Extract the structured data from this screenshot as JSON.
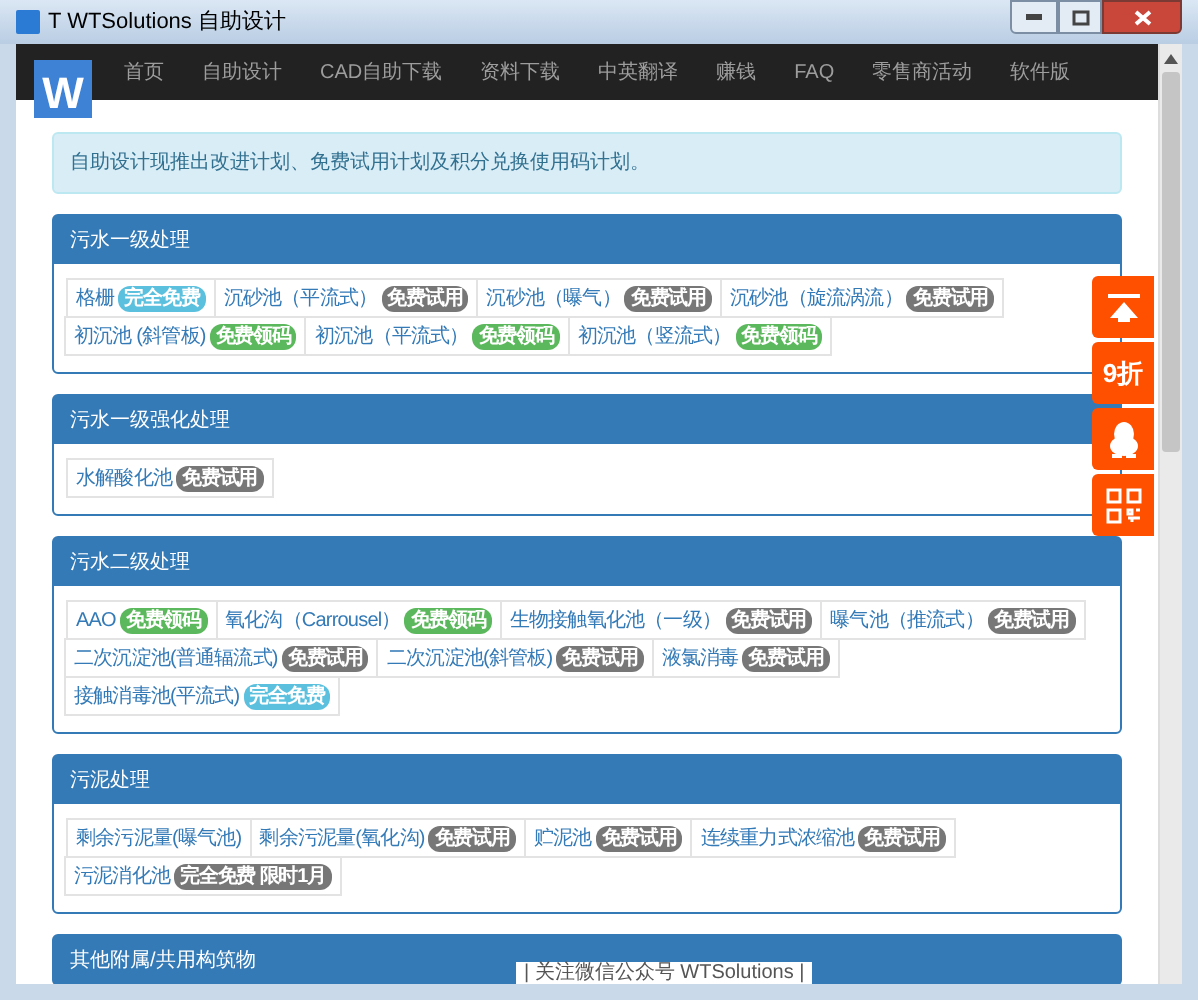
{
  "window": {
    "title": "T WTSolutions 自助设计"
  },
  "nav": {
    "logo": "W",
    "items": [
      "首页",
      "自助设计",
      "CAD自助下载",
      "资料下载",
      "中英翻译",
      "赚钱",
      "FAQ",
      "零售商活动",
      "软件版"
    ]
  },
  "notice": "自助设计现推出改进计划、免费试用计划及积分兑换使用码计划。",
  "panels": [
    {
      "title": "污水一级处理",
      "items": [
        {
          "label": "格栅",
          "badge": {
            "text": "完全免费",
            "color": "#5bc0de"
          }
        },
        {
          "label": "沉砂池（平流式）",
          "badge": {
            "text": "免费试用",
            "color": "#777777"
          }
        },
        {
          "label": "沉砂池（曝气）",
          "badge": {
            "text": "免费试用",
            "color": "#777777"
          }
        },
        {
          "label": "沉砂池（旋流涡流）",
          "badge": {
            "text": "免费试用",
            "color": "#777777"
          }
        },
        {
          "label": "初沉池 (斜管板)",
          "badge": {
            "text": "免费领码",
            "color": "#5cb85c"
          }
        },
        {
          "label": "初沉池（平流式）",
          "badge": {
            "text": "免费领码",
            "color": "#5cb85c"
          }
        },
        {
          "label": "初沉池（竖流式）",
          "badge": {
            "text": "免费领码",
            "color": "#5cb85c"
          }
        }
      ]
    },
    {
      "title": "污水一级强化处理",
      "items": [
        {
          "label": "水解酸化池",
          "badge": {
            "text": "免费试用",
            "color": "#777777"
          }
        }
      ]
    },
    {
      "title": "污水二级处理",
      "items": [
        {
          "label": "AAO",
          "badge": {
            "text": "免费领码",
            "color": "#5cb85c"
          }
        },
        {
          "label": "氧化沟（Carrousel）",
          "badge": {
            "text": "免费领码",
            "color": "#5cb85c"
          }
        },
        {
          "label": "生物接触氧化池（一级）",
          "badge": {
            "text": "免费试用",
            "color": "#777777"
          }
        },
        {
          "label": "曝气池（推流式）",
          "badge": {
            "text": "免费试用",
            "color": "#777777"
          }
        },
        {
          "label": "二次沉淀池(普通辐流式)",
          "badge": {
            "text": "免费试用",
            "color": "#777777"
          }
        },
        {
          "label": "二次沉淀池(斜管板)",
          "badge": {
            "text": "免费试用",
            "color": "#777777"
          }
        },
        {
          "label": "液氯消毒",
          "badge": {
            "text": "免费试用",
            "color": "#777777"
          }
        },
        {
          "label": "接触消毒池(平流式)",
          "badge": {
            "text": "完全免费",
            "color": "#5bc0de"
          }
        }
      ]
    },
    {
      "title": "污泥处理",
      "items": [
        {
          "label": "剩余污泥量(曝气池)"
        },
        {
          "label": "剩余污泥量(氧化沟)",
          "badge": {
            "text": "免费试用",
            "color": "#777777"
          }
        },
        {
          "label": "贮泥池",
          "badge": {
            "text": "免费试用",
            "color": "#777777"
          }
        },
        {
          "label": "连续重力式浓缩池",
          "badge": {
            "text": "免费试用",
            "color": "#777777"
          }
        },
        {
          "label": "污泥消化池",
          "badge": {
            "text": "完全免费 限时1月",
            "color": "#777777"
          }
        }
      ]
    },
    {
      "title": "其他附属/共用构筑物"
    }
  ],
  "side_buttons": [
    {
      "kind": "top"
    },
    {
      "kind": "text",
      "label": "9折"
    },
    {
      "kind": "qq"
    },
    {
      "kind": "qrcode"
    }
  ],
  "footer": "| 关注微信公众号 WTSolutions |"
}
